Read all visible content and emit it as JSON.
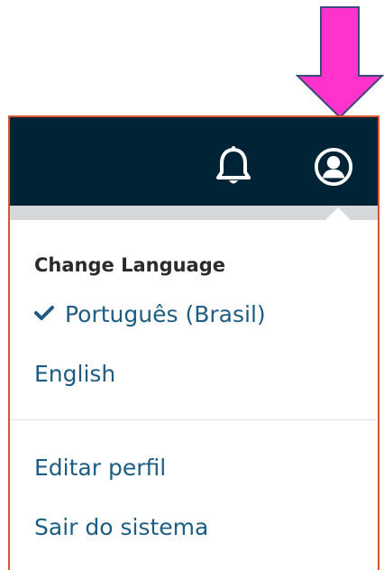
{
  "header": {
    "notifications_icon": "bell-icon",
    "user_icon": "user-avatar-icon",
    "background_color": "#002436"
  },
  "menu": {
    "heading": "Change Language",
    "languages": [
      {
        "label": "Português (Brasil)",
        "selected": true
      },
      {
        "label": "English",
        "selected": false
      }
    ],
    "actions": [
      {
        "label": "Editar perfil"
      },
      {
        "label": "Sair do sistema"
      }
    ],
    "link_color": "#1d5d84"
  },
  "annotation": {
    "arrow_color": "#ff33cc"
  }
}
